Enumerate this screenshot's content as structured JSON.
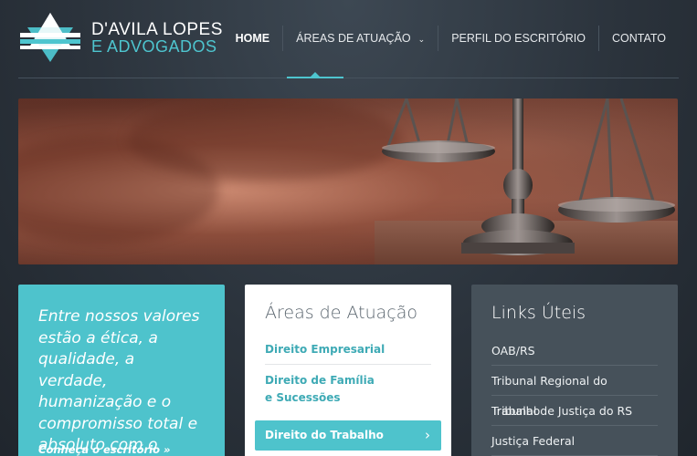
{
  "header": {
    "logo": {
      "line1": "D'AVILA LOPES",
      "line2": "E ADVOGADOS"
    },
    "nav": [
      {
        "label": "HOME",
        "active": true
      },
      {
        "label": "ÁREAS DE ATUAÇÃO",
        "has_dropdown": true
      },
      {
        "label": "PERFIL DO ESCRITÓRIO"
      },
      {
        "label": "CONTATO"
      }
    ]
  },
  "quote": {
    "text": "Entre nossos valores estão a ética, a qualidade, a verdade, humanização e o compromisso total e absoluto com o cliente.",
    "link": "Conheça o escritório »"
  },
  "areas": {
    "title": "Áreas de Atuação",
    "items": [
      {
        "label": "Direito Empresarial"
      },
      {
        "label_line1": "Direito de Família",
        "label_line2": "e Sucessões"
      },
      {
        "label": "Direito do Trabalho",
        "active": true,
        "icon": "chevron-right-icon"
      }
    ]
  },
  "links": {
    "title": "Links Úteis",
    "items": [
      {
        "label": "OAB/RS"
      },
      {
        "label": "Tribunal Regional do Trabalho"
      },
      {
        "label": "Tribunal de Justiça do RS"
      },
      {
        "label": "Justiça Federal"
      }
    ]
  },
  "colors": {
    "accent": "#4ec3cc",
    "background": "#2b333c",
    "links_card": "#46515a"
  }
}
